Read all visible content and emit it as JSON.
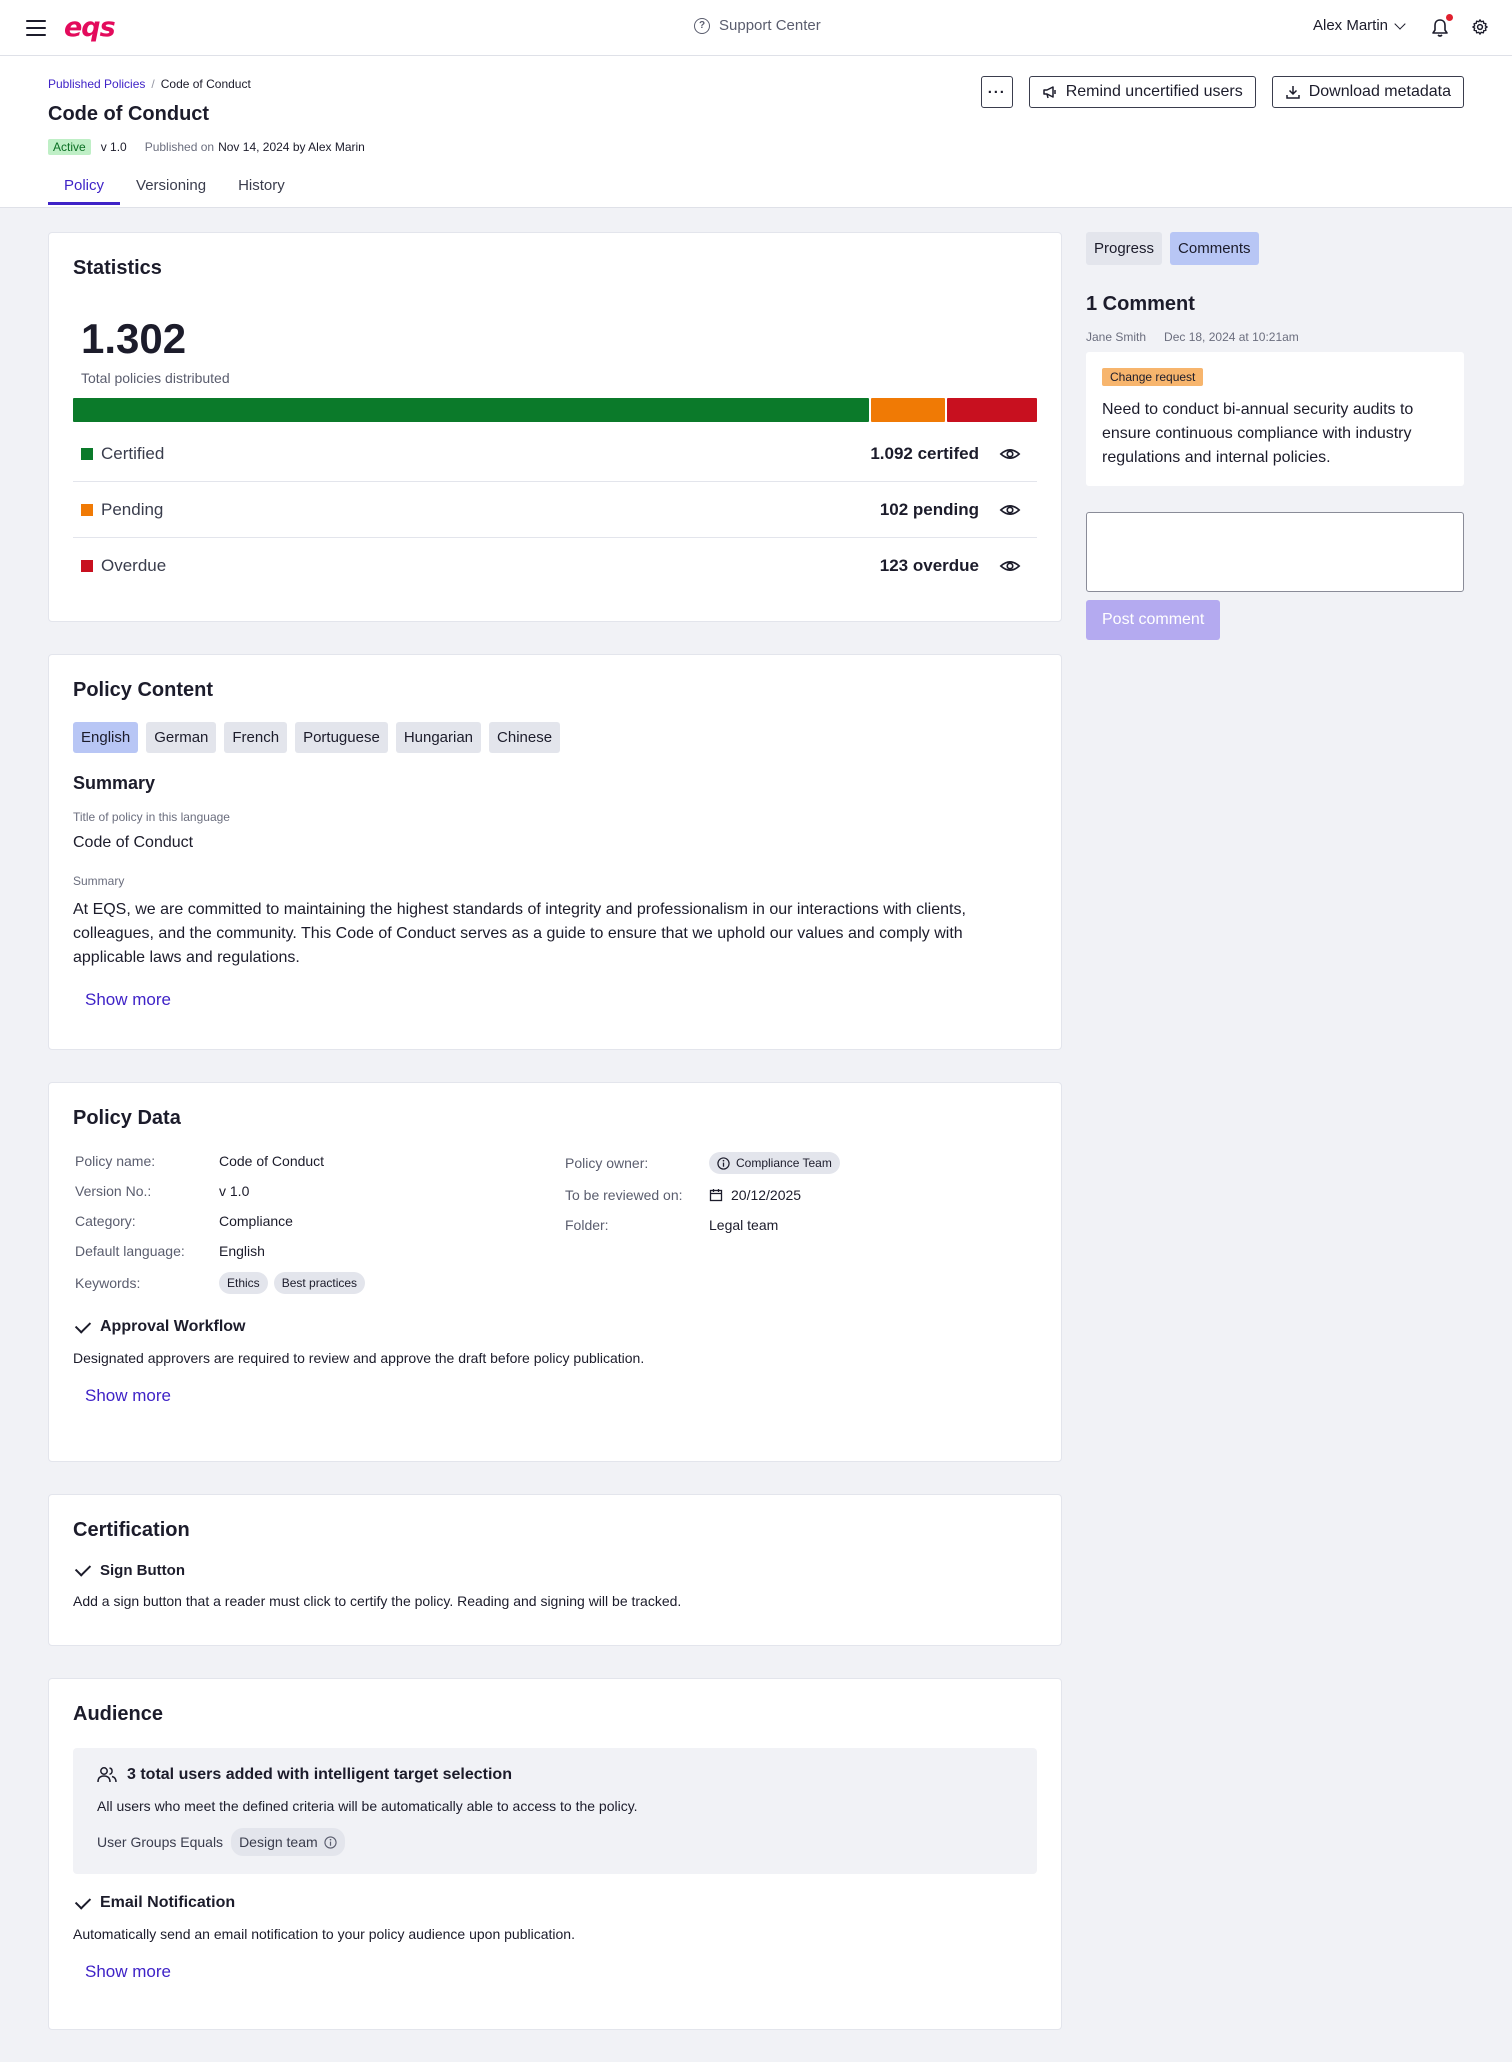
{
  "app": {
    "logo_text": "eqs",
    "support_label": "Support Center",
    "user_name": "Alex Martin",
    "accent": "#3f23c7",
    "brand": "#e30b5c"
  },
  "header": {
    "breadcrumb": [
      "Published Policies",
      "Code of Conduct"
    ],
    "breadcrumb_sep": "/",
    "title": "Code of Conduct",
    "status": "Active",
    "version": "v 1.0",
    "published_label": "Published on",
    "published_value": "Nov 14, 2024 by Alex Marin",
    "more_label": "···",
    "remind_label": "Remind uncertified users",
    "download_label": "Download metadata",
    "tabs": [
      "Policy",
      "Versioning",
      "History"
    ],
    "active_tab": "Policy"
  },
  "statistics": {
    "title": "Statistics",
    "total": "1.302",
    "total_label": "Total policies distributed",
    "rows": [
      {
        "label": "Certified",
        "value": "1.092 certifed",
        "count": 1092,
        "color": "#0b7a2a"
      },
      {
        "label": "Pending",
        "value": "102 pending",
        "count": 102,
        "color": "#f07a05"
      },
      {
        "label": "Overdue",
        "value": "123 overdue",
        "count": 123,
        "color": "#c8101f"
      }
    ]
  },
  "policy_content": {
    "title": "Policy Content",
    "languages": [
      "English",
      "German",
      "French",
      "Portuguese",
      "Hungarian",
      "Chinese"
    ],
    "active_language": "English",
    "summary_heading": "Summary",
    "title_field_label": "Title of policy in this language",
    "title_field_value": "Code of Conduct",
    "summary_field_label": "Summary",
    "summary_text": "At EQS, we are committed to maintaining the highest standards of integrity and professionalism in our interactions with clients, colleagues, and the community. This Code of Conduct serves as a guide to ensure that we uphold our values and comply with applicable laws and regulations.",
    "show_more": "Show more"
  },
  "policy_data": {
    "title": "Policy Data",
    "left": [
      {
        "k": "Policy name:",
        "v": "Code of Conduct"
      },
      {
        "k": "Version No.:",
        "v": "v 1.0"
      },
      {
        "k": "Category:",
        "v": "Compliance"
      },
      {
        "k": "Default language:",
        "v": "English"
      }
    ],
    "keywords_label": "Keywords:",
    "keywords": [
      "Ethics",
      "Best practices"
    ],
    "owner_label": "Policy owner:",
    "owner_value": "Compliance Team",
    "review_label": "To be reviewed on:",
    "review_value": "20/12/2025",
    "folder_label": "Folder:",
    "folder_value": "Legal team",
    "workflow_title": "Approval Workflow",
    "workflow_text": "Designated approvers are required to review and approve the draft before policy publication.",
    "show_more": "Show more"
  },
  "certification": {
    "title": "Certification",
    "option_title": "Sign Button",
    "option_text": "Add a sign button that a reader must click to certify the policy. Reading and signing will be tracked."
  },
  "audience": {
    "title": "Audience",
    "box_title": "3 total users added with intelligent target selection",
    "box_text": "All users who meet the defined criteria will be automatically able to access to the policy.",
    "filter_label": "User Groups Equals",
    "filter_value": "Design team",
    "email_title": "Email Notification",
    "email_text": "Automatically send an email notification to your policy audience upon publication.",
    "show_more": "Show more"
  },
  "side": {
    "tabs": [
      "Progress",
      "Comments"
    ],
    "active_tab": "Comments",
    "heading": "1 Comment",
    "comment": {
      "author": "Jane Smith",
      "date": "Dec 18, 2024 at 10:21am",
      "tag": "Change request",
      "text": "Need to conduct bi-annual security audits to ensure continuous compliance with industry regulations and internal policies."
    },
    "input_placeholder": "",
    "post_label": "Post comment"
  }
}
